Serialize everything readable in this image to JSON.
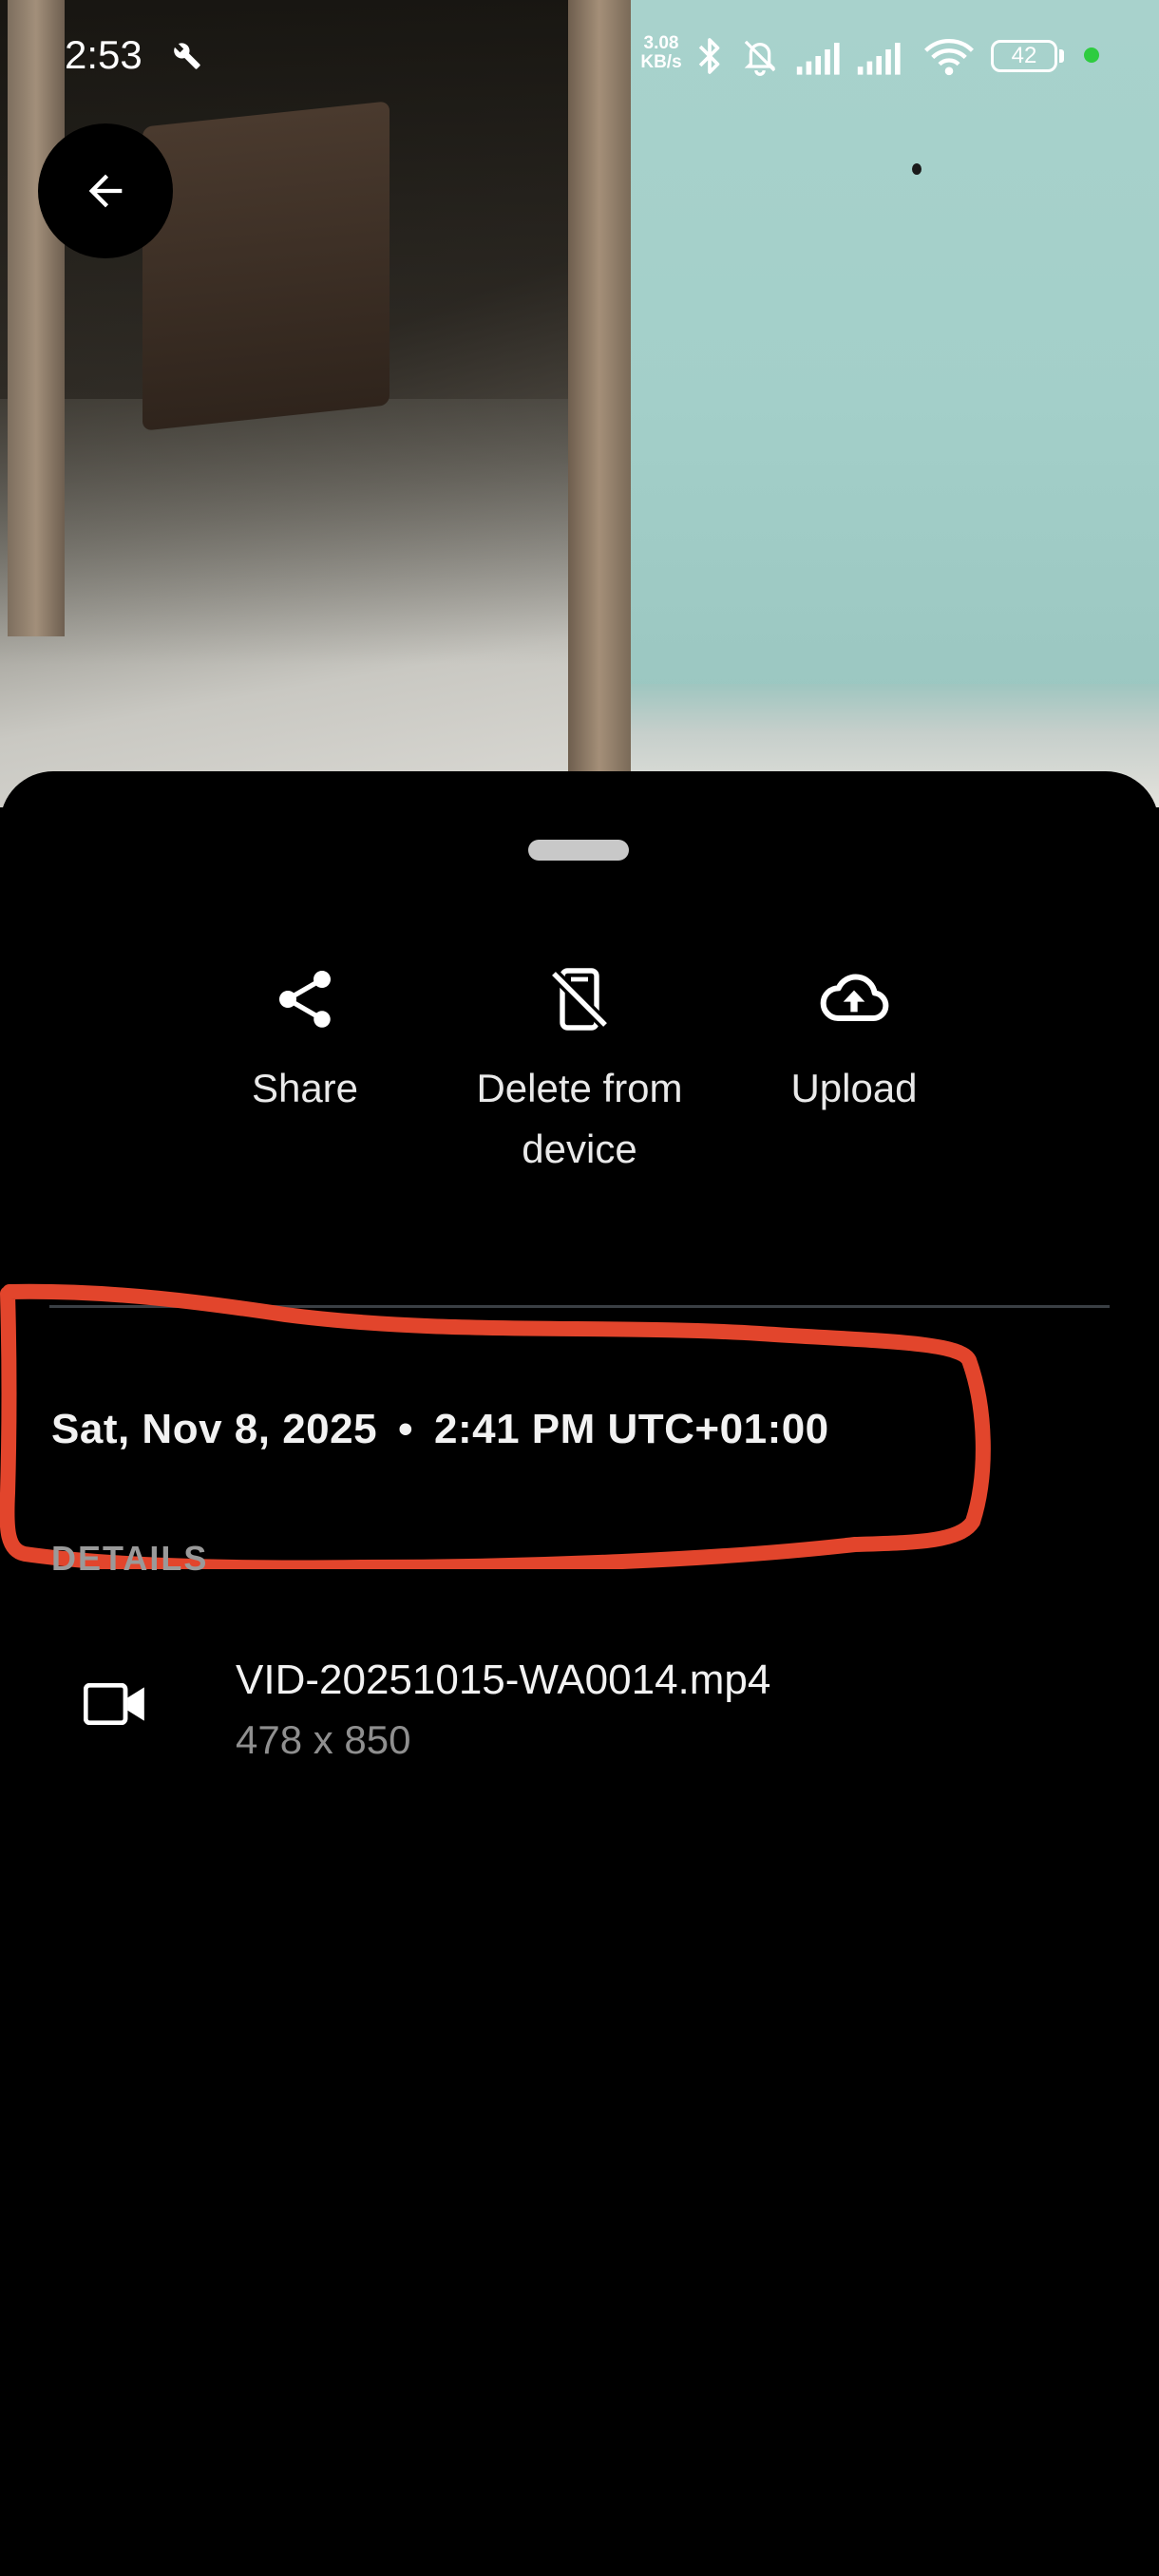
{
  "status_bar": {
    "time": "2:53",
    "net_speed_value": "3.08",
    "net_speed_unit": "KB/s",
    "battery_level": "42"
  },
  "actions": [
    {
      "label": "Share",
      "icon": "share-icon"
    },
    {
      "label": "Delete from device",
      "icon": "phone-delete-icon"
    },
    {
      "label": "Upload",
      "icon": "cloud-upload-icon"
    }
  ],
  "info": {
    "date": "Sat, Nov 8, 2025",
    "separator": "•",
    "time": "2:41 PM UTC+01:00"
  },
  "details": {
    "heading": "DETAILS",
    "file_name": "VID-20251015-WA0014.mp4",
    "dimensions": "478 x 850",
    "file_icon": "videocam-icon"
  },
  "colors": {
    "annotation_red": "#e2452c",
    "sheet_background": "#000000",
    "battery_dot": "#2ecc40"
  }
}
